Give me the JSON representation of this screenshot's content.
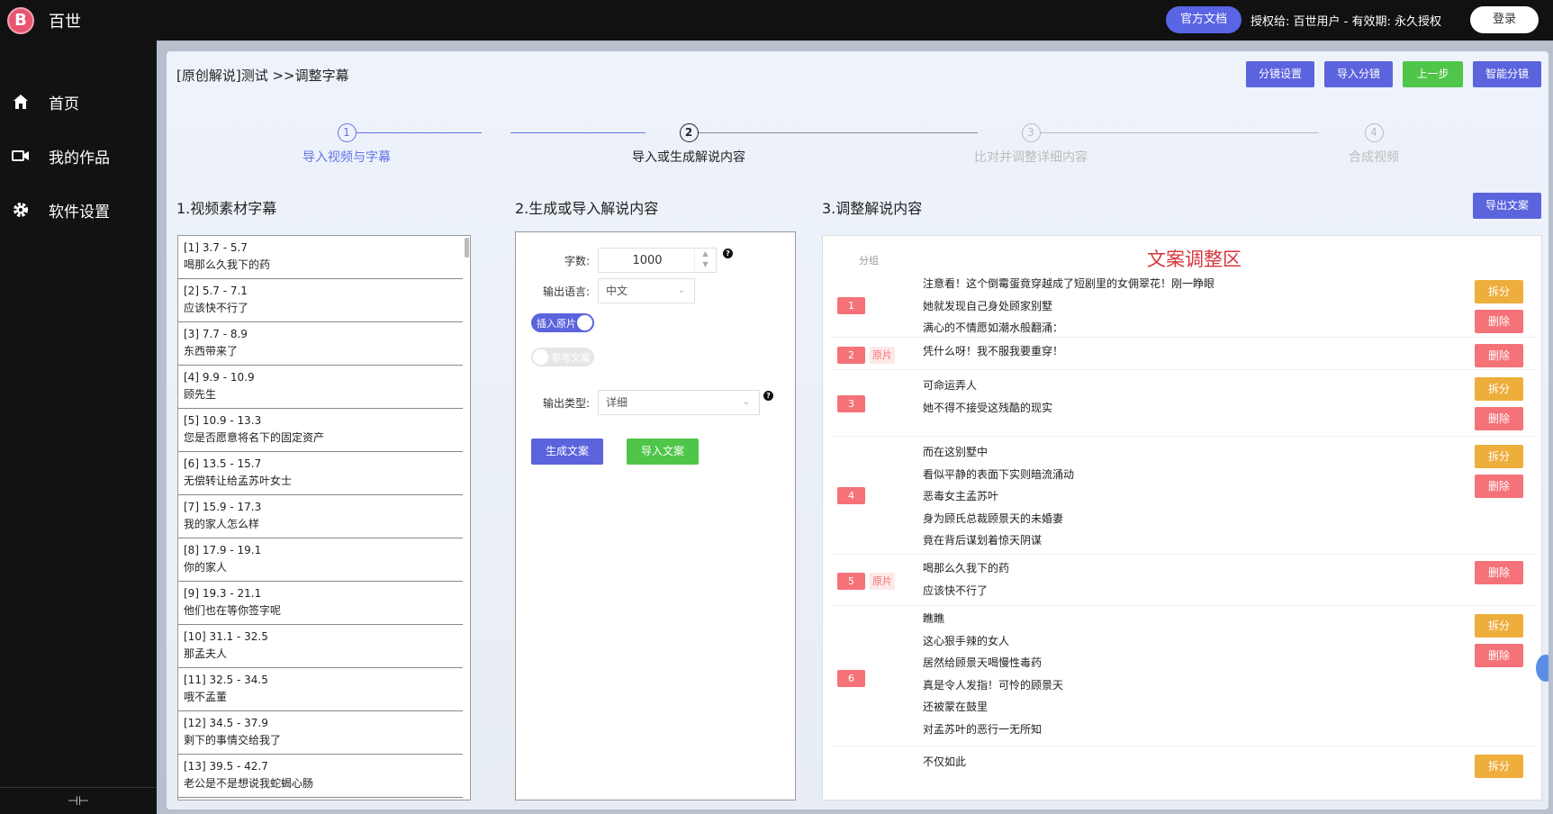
{
  "app": {
    "title": "百世"
  },
  "topbar": {
    "docs_label": "官方文档",
    "license_text": "授权给: 百世用户 - 有效期: 永久授权",
    "login_label": "登录"
  },
  "sidebar": {
    "items": [
      {
        "label": "首页",
        "icon": "home-icon"
      },
      {
        "label": "我的作品",
        "icon": "video-icon"
      },
      {
        "label": "软件设置",
        "icon": "gear-icon"
      }
    ],
    "bottom_icon": "collapse-icon"
  },
  "breadcrumb": "[原创解说]测试 >>调整字幕",
  "top_actions": {
    "split_settings": "分镜设置",
    "import_split": "导入分镜",
    "prev_step": "上一步",
    "smart_split": "智能分镜"
  },
  "steps": [
    {
      "num": "1",
      "label": "导入视频与字幕",
      "state": "done"
    },
    {
      "num": "2",
      "label": "导入或生成解说内容",
      "state": "active"
    },
    {
      "num": "3",
      "label": "比对并调整详细内容",
      "state": "pending"
    },
    {
      "num": "4",
      "label": "合成视频",
      "state": "pending"
    }
  ],
  "sections": {
    "col1_title": "1.视频素材字幕",
    "col2_title": "2.生成或导入解说内容",
    "col3_title": "3.调整解说内容",
    "export_label": "导出文案"
  },
  "subtitles": [
    {
      "time": "[1] 3.7 - 5.7",
      "text": "喝那么久我下的药"
    },
    {
      "time": "[2] 5.7 - 7.1",
      "text": "应该快不行了"
    },
    {
      "time": "[3] 7.7 - 8.9",
      "text": "东西带来了"
    },
    {
      "time": "[4] 9.9 - 10.9",
      "text": "顾先生"
    },
    {
      "time": "[5] 10.9 - 13.3",
      "text": "您是否愿意将名下的固定资产"
    },
    {
      "time": "[6] 13.5 - 15.7",
      "text": "无偿转让给孟苏叶女士"
    },
    {
      "time": "[7] 15.9 - 17.3",
      "text": "我的家人怎么样"
    },
    {
      "time": "[8] 17.9 - 19.1",
      "text": "你的家人"
    },
    {
      "time": "[9] 19.3 - 21.1",
      "text": "他们也在等你签字呢"
    },
    {
      "time": "[10] 31.1 - 32.5",
      "text": "那孟夫人"
    },
    {
      "time": "[11] 32.5 - 34.5",
      "text": "哦不孟董"
    },
    {
      "time": "[12] 34.5 - 37.9",
      "text": "剩下的事情交给我了"
    },
    {
      "time": "[13] 39.5 - 42.7",
      "text": "老公是不是想说我蛇蝎心肠"
    }
  ],
  "generate": {
    "word_count_label": "字数:",
    "word_count_value": "1000",
    "language_label": "输出语言:",
    "language_value": "中文",
    "insert_original_label": "插入原片",
    "insert_original_on": true,
    "reference_label": "参考文案",
    "reference_on": false,
    "output_type_label": "输出类型:",
    "output_type_value": "详细",
    "generate_btn": "生成文案",
    "import_btn": "导入文案"
  },
  "adjust": {
    "group_header": "分组",
    "zone_title": "文案调整区",
    "split_label": "拆分",
    "delete_label": "删除",
    "original_tag": "原片",
    "groups": [
      {
        "id": "1",
        "original": false,
        "lines": [
          "注意看！这个倒霉蛋竟穿越成了短剧里的女佣翠花！刚一睁眼",
          "她就发现自己身处顾家别墅",
          "满心的不情愿如潮水般翻涌："
        ]
      },
      {
        "id": "2",
        "original": true,
        "lines": [
          "凭什么呀！我不服我要重穿！"
        ]
      },
      {
        "id": "3",
        "original": false,
        "lines": [
          "可命运弄人",
          "她不得不接受这残酷的现实"
        ]
      },
      {
        "id": "4",
        "original": false,
        "lines": [
          "而在这别墅中",
          "看似平静的表面下实则暗流涌动",
          "恶毒女主孟苏叶",
          "身为顾氏总裁顾景天的未婚妻",
          "竟在背后谋划着惊天阴谋"
        ]
      },
      {
        "id": "5",
        "original": true,
        "lines": [
          "喝那么久我下的药",
          "应该快不行了"
        ]
      },
      {
        "id": "6",
        "original": false,
        "lines": [
          "瞧瞧",
          "这心狠手辣的女人",
          "居然给顾景天喝慢性毒药",
          "真是令人发指！可怜的顾景天",
          "还被蒙在鼓里",
          "对孟苏叶的恶行一无所知"
        ]
      },
      {
        "id": "7",
        "original": false,
        "lines": [
          "不仅如此"
        ]
      }
    ]
  }
}
